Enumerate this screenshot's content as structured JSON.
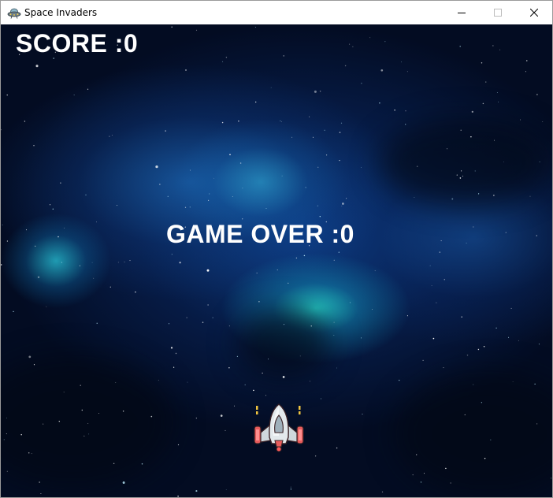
{
  "window": {
    "title": "Space Invaders",
    "app_icon": "ufo-icon",
    "controls": {
      "minimize_icon": "minimize-icon",
      "maximize_icon": "maximize-icon",
      "close_icon": "close-icon"
    }
  },
  "game": {
    "score_text": "SCORE :0",
    "game_over_text": "GAME OVER :0",
    "score": 0,
    "player": {
      "sprite": "spaceship-icon"
    },
    "colors": {
      "text": "#ffffff",
      "background": "#020814",
      "nebula": "#1fd6cf"
    }
  }
}
